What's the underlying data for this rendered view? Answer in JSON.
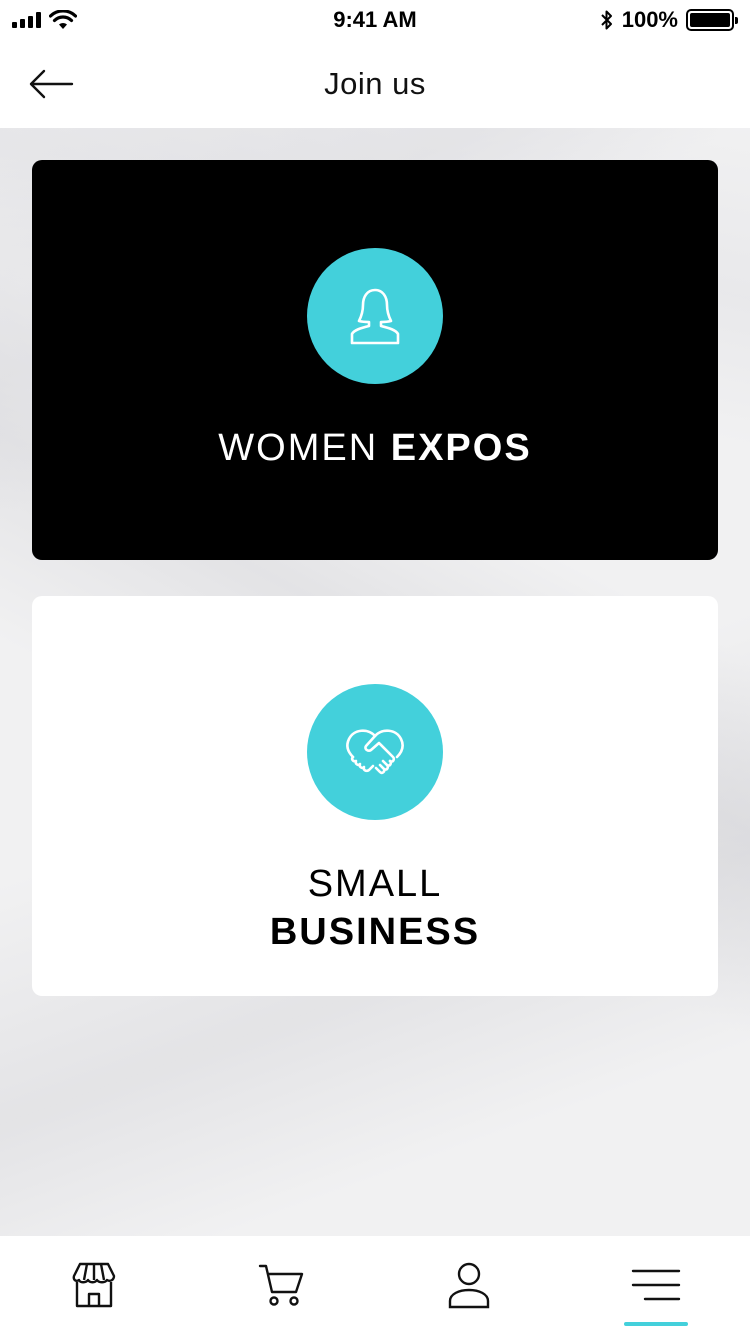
{
  "status_bar": {
    "time": "9:41 AM",
    "battery_label": "100%",
    "battery_level": 1.0,
    "icons": [
      "signal-icon",
      "wifi-icon",
      "bluetooth-icon",
      "battery-icon"
    ]
  },
  "nav": {
    "title": "Join us",
    "back_icon": "arrow-left-icon"
  },
  "cards": [
    {
      "id": "women-expos",
      "icon": "woman-icon",
      "title_light": "WOMEN ",
      "title_bold": "EXPOS",
      "theme": "dark"
    },
    {
      "id": "small-business",
      "icon": "handshake-icon",
      "title_light": "SMALL",
      "title_bold": "BUSINESS",
      "theme": "light"
    }
  ],
  "tabs": [
    {
      "icon": "store-icon",
      "active": false
    },
    {
      "icon": "cart-icon",
      "active": false
    },
    {
      "icon": "user-icon",
      "active": false
    },
    {
      "icon": "menu-icon",
      "active": true
    }
  ],
  "colors": {
    "accent": "#43d0db",
    "dark_card": "#000000",
    "light_card": "#ffffff"
  }
}
